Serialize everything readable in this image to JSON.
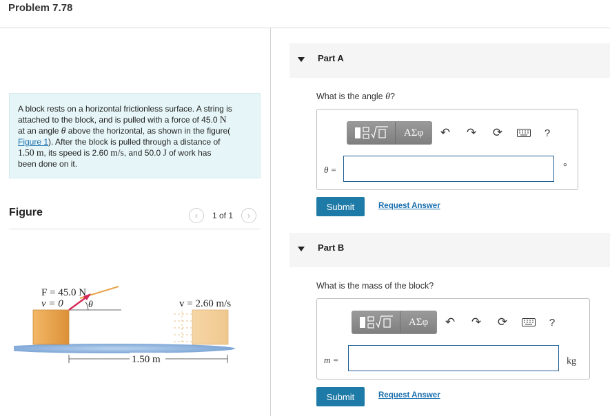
{
  "problem": {
    "title": "Problem 7.78"
  },
  "statement": {
    "line1": "A block rests on a horizontal frictionless surface. A string is",
    "line2a": "attached to the block, and is pulled with a force of 45.0 ",
    "line2_unit": "N",
    "line3a": "at an angle ",
    "line3_theta": "θ",
    "line3b": " above the horizontal, as shown in the figure(",
    "figure_link": "Figure 1",
    "line4b": "). After the block is pulled through a distance of",
    "line5_dist": "1.50 m",
    "line5b": ", its speed is 2.60 ",
    "line5_speed_unit": "m/s",
    "line5c": ", and 50.0 ",
    "line5_work_unit": "J",
    "line5d": " of work has",
    "line6": "been done on it."
  },
  "figure": {
    "heading": "Figure",
    "pager": "1 of 1",
    "prev_icon": "chevron-left-icon",
    "next_icon": "chevron-right-icon",
    "force_label": "F = 45.0 N",
    "v0_label": "v = 0",
    "theta_label": "θ",
    "v_final_label": "v = 2.60 m/s",
    "distance_label": "1.50 m",
    "block_color": "#e8a24a",
    "surface_color": "#8fb5de",
    "arrow_color": "#d62a5a"
  },
  "parts": [
    {
      "name": "Part A",
      "question_prefix": "What is the angle ",
      "question_var": "θ",
      "question_suffix": "?",
      "variable_label": "θ =",
      "unit": "°",
      "input_value": "",
      "submit_label": "Submit",
      "request_label": "Request Answer"
    },
    {
      "name": "Part B",
      "question_prefix": "What is the mass of the block?",
      "variable_label": "m =",
      "unit": "kg",
      "input_value": "",
      "submit_label": "Submit",
      "request_label": "Request Answer"
    }
  ],
  "toolbar": {
    "template_icon": "fraction-radical-template-icon",
    "greek_label": "ΑΣφ",
    "undo_icon": "undo-icon",
    "redo_icon": "redo-icon",
    "reset_icon": "reset-icon",
    "keyboard_icon": "keyboard-icon",
    "help_label": "?"
  },
  "colors": {
    "accent": "#1e7aa6",
    "link": "#1a6fae",
    "statement_bg": "#e6f5f7",
    "part_header_bg": "#f5f5f5"
  }
}
